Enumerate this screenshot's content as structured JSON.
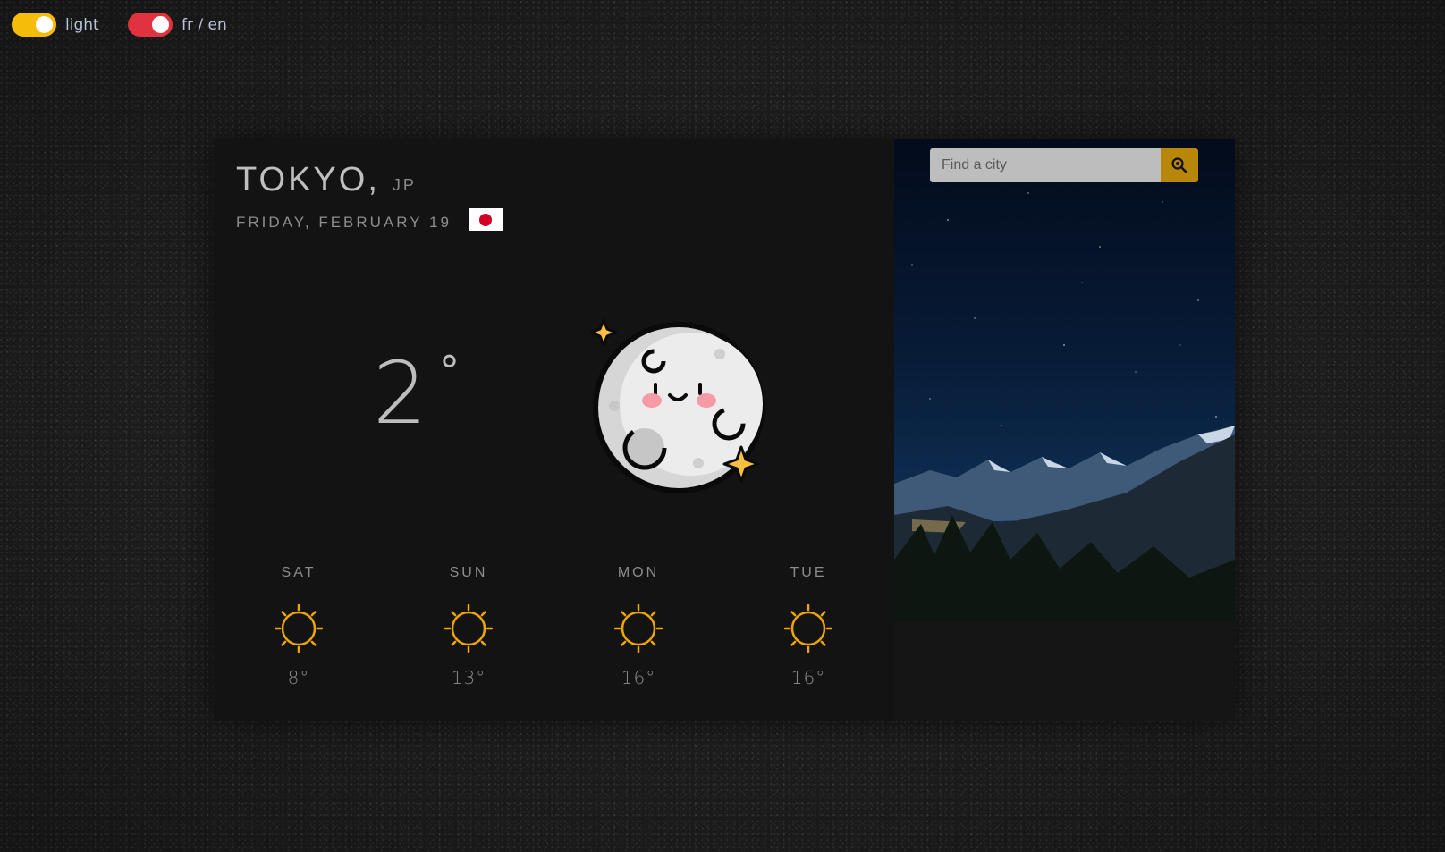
{
  "toggles": {
    "theme": {
      "label": "light",
      "color": "#f5bd0a"
    },
    "language": {
      "label": "fr / en",
      "color": "#e0323f"
    }
  },
  "location": {
    "city": "TOKYO,",
    "country": "JP",
    "date": "FRIDAY, FEBRUARY 19",
    "flag_icon": "japan-flag-icon"
  },
  "current": {
    "temperature": "2",
    "degree_symbol": "°",
    "icon": "moon-icon"
  },
  "forecast": [
    {
      "day": "SAT",
      "icon": "sun-icon",
      "temp": "8°"
    },
    {
      "day": "SUN",
      "icon": "sun-icon",
      "temp": "13°"
    },
    {
      "day": "MON",
      "icon": "sun-icon",
      "temp": "16°"
    },
    {
      "day": "TUE",
      "icon": "sun-icon",
      "temp": "16°"
    }
  ],
  "search": {
    "placeholder": "Find a city",
    "button_icon": "search-icon",
    "button_color": "#b8870a"
  }
}
